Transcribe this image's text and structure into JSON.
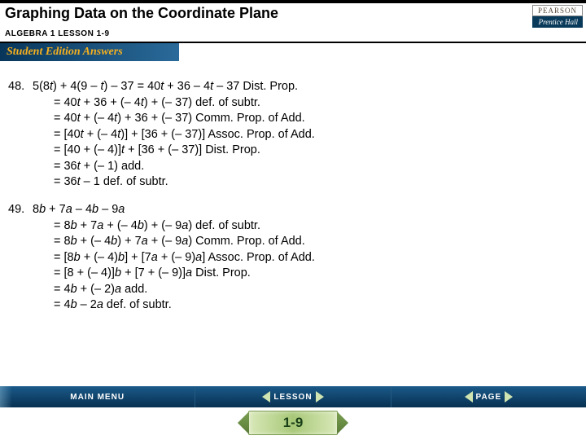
{
  "header": {
    "title": "Graphing Data on the Coordinate Plane",
    "subtitle": "ALGEBRA 1  LESSON 1-9",
    "answers_label": "Student Edition Answers"
  },
  "logo": {
    "top": "PEARSON",
    "bottom": "Prentice Hall"
  },
  "problems": [
    {
      "num": "48.",
      "first": "5(8<i>t</i>) + 4(9 – <i>t</i>) – 37 = 40<i>t</i> + 36 – 4<i>t</i> – 37  Dist. Prop.",
      "steps": [
        "= 40<i>t</i> + 36 + (– 4<i>t</i>) + (– 37)  def. of subtr.",
        "= 40<i>t</i> + (– 4<i>t</i>) + 36 + (– 37)  Comm. Prop. of Add.",
        "= [40<i>t</i> + (– 4<i>t</i>)] + [36 + (– 37)]  Assoc. Prop. of Add.",
        "= [40 + (– 4)]<i>t</i> + [36 + (– 37)]  Dist. Prop.",
        "= 36<i>t</i> + (– 1)  add.",
        "= 36<i>t</i> – 1  def. of subtr."
      ]
    },
    {
      "num": "49.",
      "first": "8<i>b</i> + 7<i>a</i> – 4<i>b</i> – 9<i>a</i>",
      "steps": [
        "= 8<i>b</i> + 7<i>a</i> + (– 4<i>b</i>) + (– 9<i>a</i>)  def. of subtr.",
        "= 8<i>b</i> + (– 4<i>b</i>) + 7<i>a</i> + (– 9<i>a</i>)  Comm. Prop. of Add.",
        "= [8<i>b</i> + (– 4)<i>b</i>] + [7<i>a</i> + (– 9)<i>a</i>]  Assoc. Prop. of Add.",
        "= [8 + (– 4)]<i>b</i> + [7 + (– 9)]<i>a</i>  Dist. Prop.",
        "= 4<i>b</i> + (– 2)<i>a</i>  add.",
        "= 4<i>b</i> – 2<i>a</i>  def. of subtr."
      ]
    }
  ],
  "footer": {
    "main_menu": "MAIN MENU",
    "lesson": "LESSON",
    "page": "PAGE",
    "page_number": "1-9"
  }
}
